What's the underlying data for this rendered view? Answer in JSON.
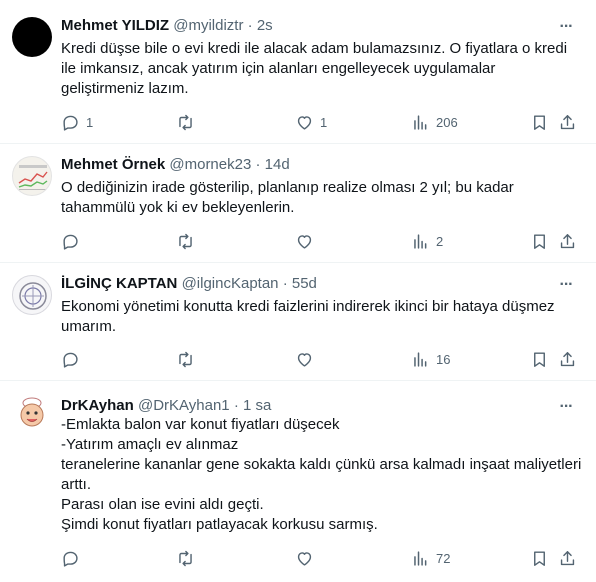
{
  "tweets": [
    {
      "name": "Mehmet YILDIZ",
      "handle": "@myildiztr",
      "time": "2s",
      "text": "Kredi düşse bile o evi kredi ile alacak adam bulamazsınız. O fiyatlara o kredi ile imkansız, ancak yatırım için alanları engelleyecek uygulamalar geliştirmeniz lazım.",
      "replies": "1",
      "retweets": "",
      "likes": "1",
      "views": "206"
    },
    {
      "name": "Mehmet Örnek",
      "handle": "@mornek23",
      "time": "14d",
      "text": "O dediğinizin irade gösterilip, planlanıp realize olması 2 yıl; bu kadar tahammülü yok ki ev bekleyenlerin.",
      "replies": "",
      "retweets": "",
      "likes": "",
      "views": "2"
    },
    {
      "name": "İLGİNÇ KAPTAN",
      "handle": "@ilgincKaptan",
      "time": "55d",
      "text": "Ekonomi yönetimi konutta kredi faizlerini indirerek ikinci bir hataya düşmez umarım.",
      "replies": "",
      "retweets": "",
      "likes": "",
      "views": "16"
    },
    {
      "name": "DrKAyhan",
      "handle": "@DrKAyhan1",
      "time": "1 sa",
      "text": "-Emlakta balon var konut fiyatları düşecek\n-Yatırım amaçlı ev alınmaz\nteranelerine kananlar gene sokakta kaldı çünkü arsa kalmadı inşaat maliyetleri arttı.\nParası olan ise evini aldı geçti.\nŞimdi konut fiyatları patlayacak korkusu sarmış.",
      "replies": "",
      "retweets": "",
      "likes": "",
      "views": "72"
    }
  ],
  "colors": {
    "text": "#0f1419",
    "secondary": "#536471",
    "divider": "#eff3f4"
  }
}
